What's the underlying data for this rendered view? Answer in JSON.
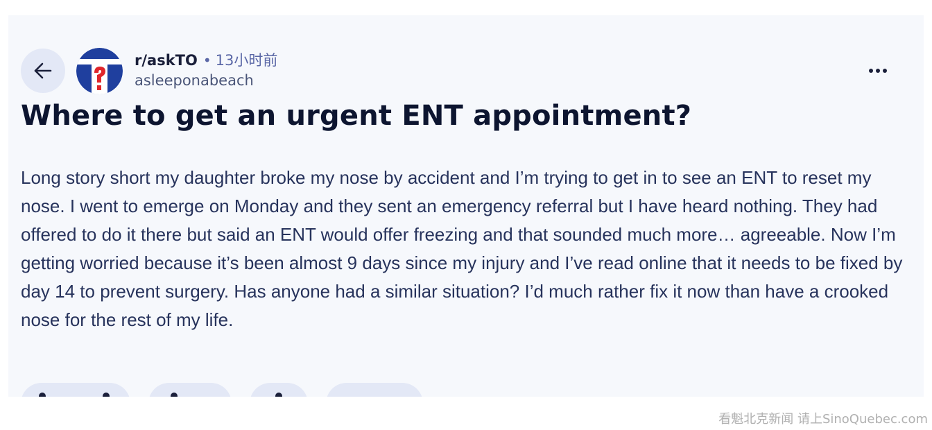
{
  "post": {
    "subreddit": "r/askTO",
    "separator": "•",
    "time_ago": "13小时前",
    "author": "asleeponabeach",
    "title": "Where to get an urgent ENT appointment?",
    "body": "Long story short my daughter broke my nose by accident and I’m trying to get in to see an ENT to reset my nose. I went to emerge on Monday and they sent an emergency referral but I have heard nothing. They had offered to do it there but said an ENT would offer freezing and that sounded much more… agreeable. Now I’m getting worried because it’s been almost 9 days since my injury and I’ve read online that it needs to be fixed by day 14 to prevent surgery. Has anyone had a similar situation? I’d much rather fix it now than have a crooked nose for the rest of my life."
  },
  "icons": {
    "back": "arrow-left-icon",
    "avatar": "subreddit-avatar",
    "more": "more-horizontal-icon"
  },
  "colors": {
    "card_background": "#f6f8fc",
    "button_background": "#e3e8f6",
    "title_color": "#0d1530",
    "body_color": "#27335c",
    "meta_color": "#5a67a6",
    "avatar_blue": "#1f3f9e",
    "avatar_red": "#e0262b"
  },
  "watermark": "看魁北克新闻 请上SinoQuebec.com"
}
